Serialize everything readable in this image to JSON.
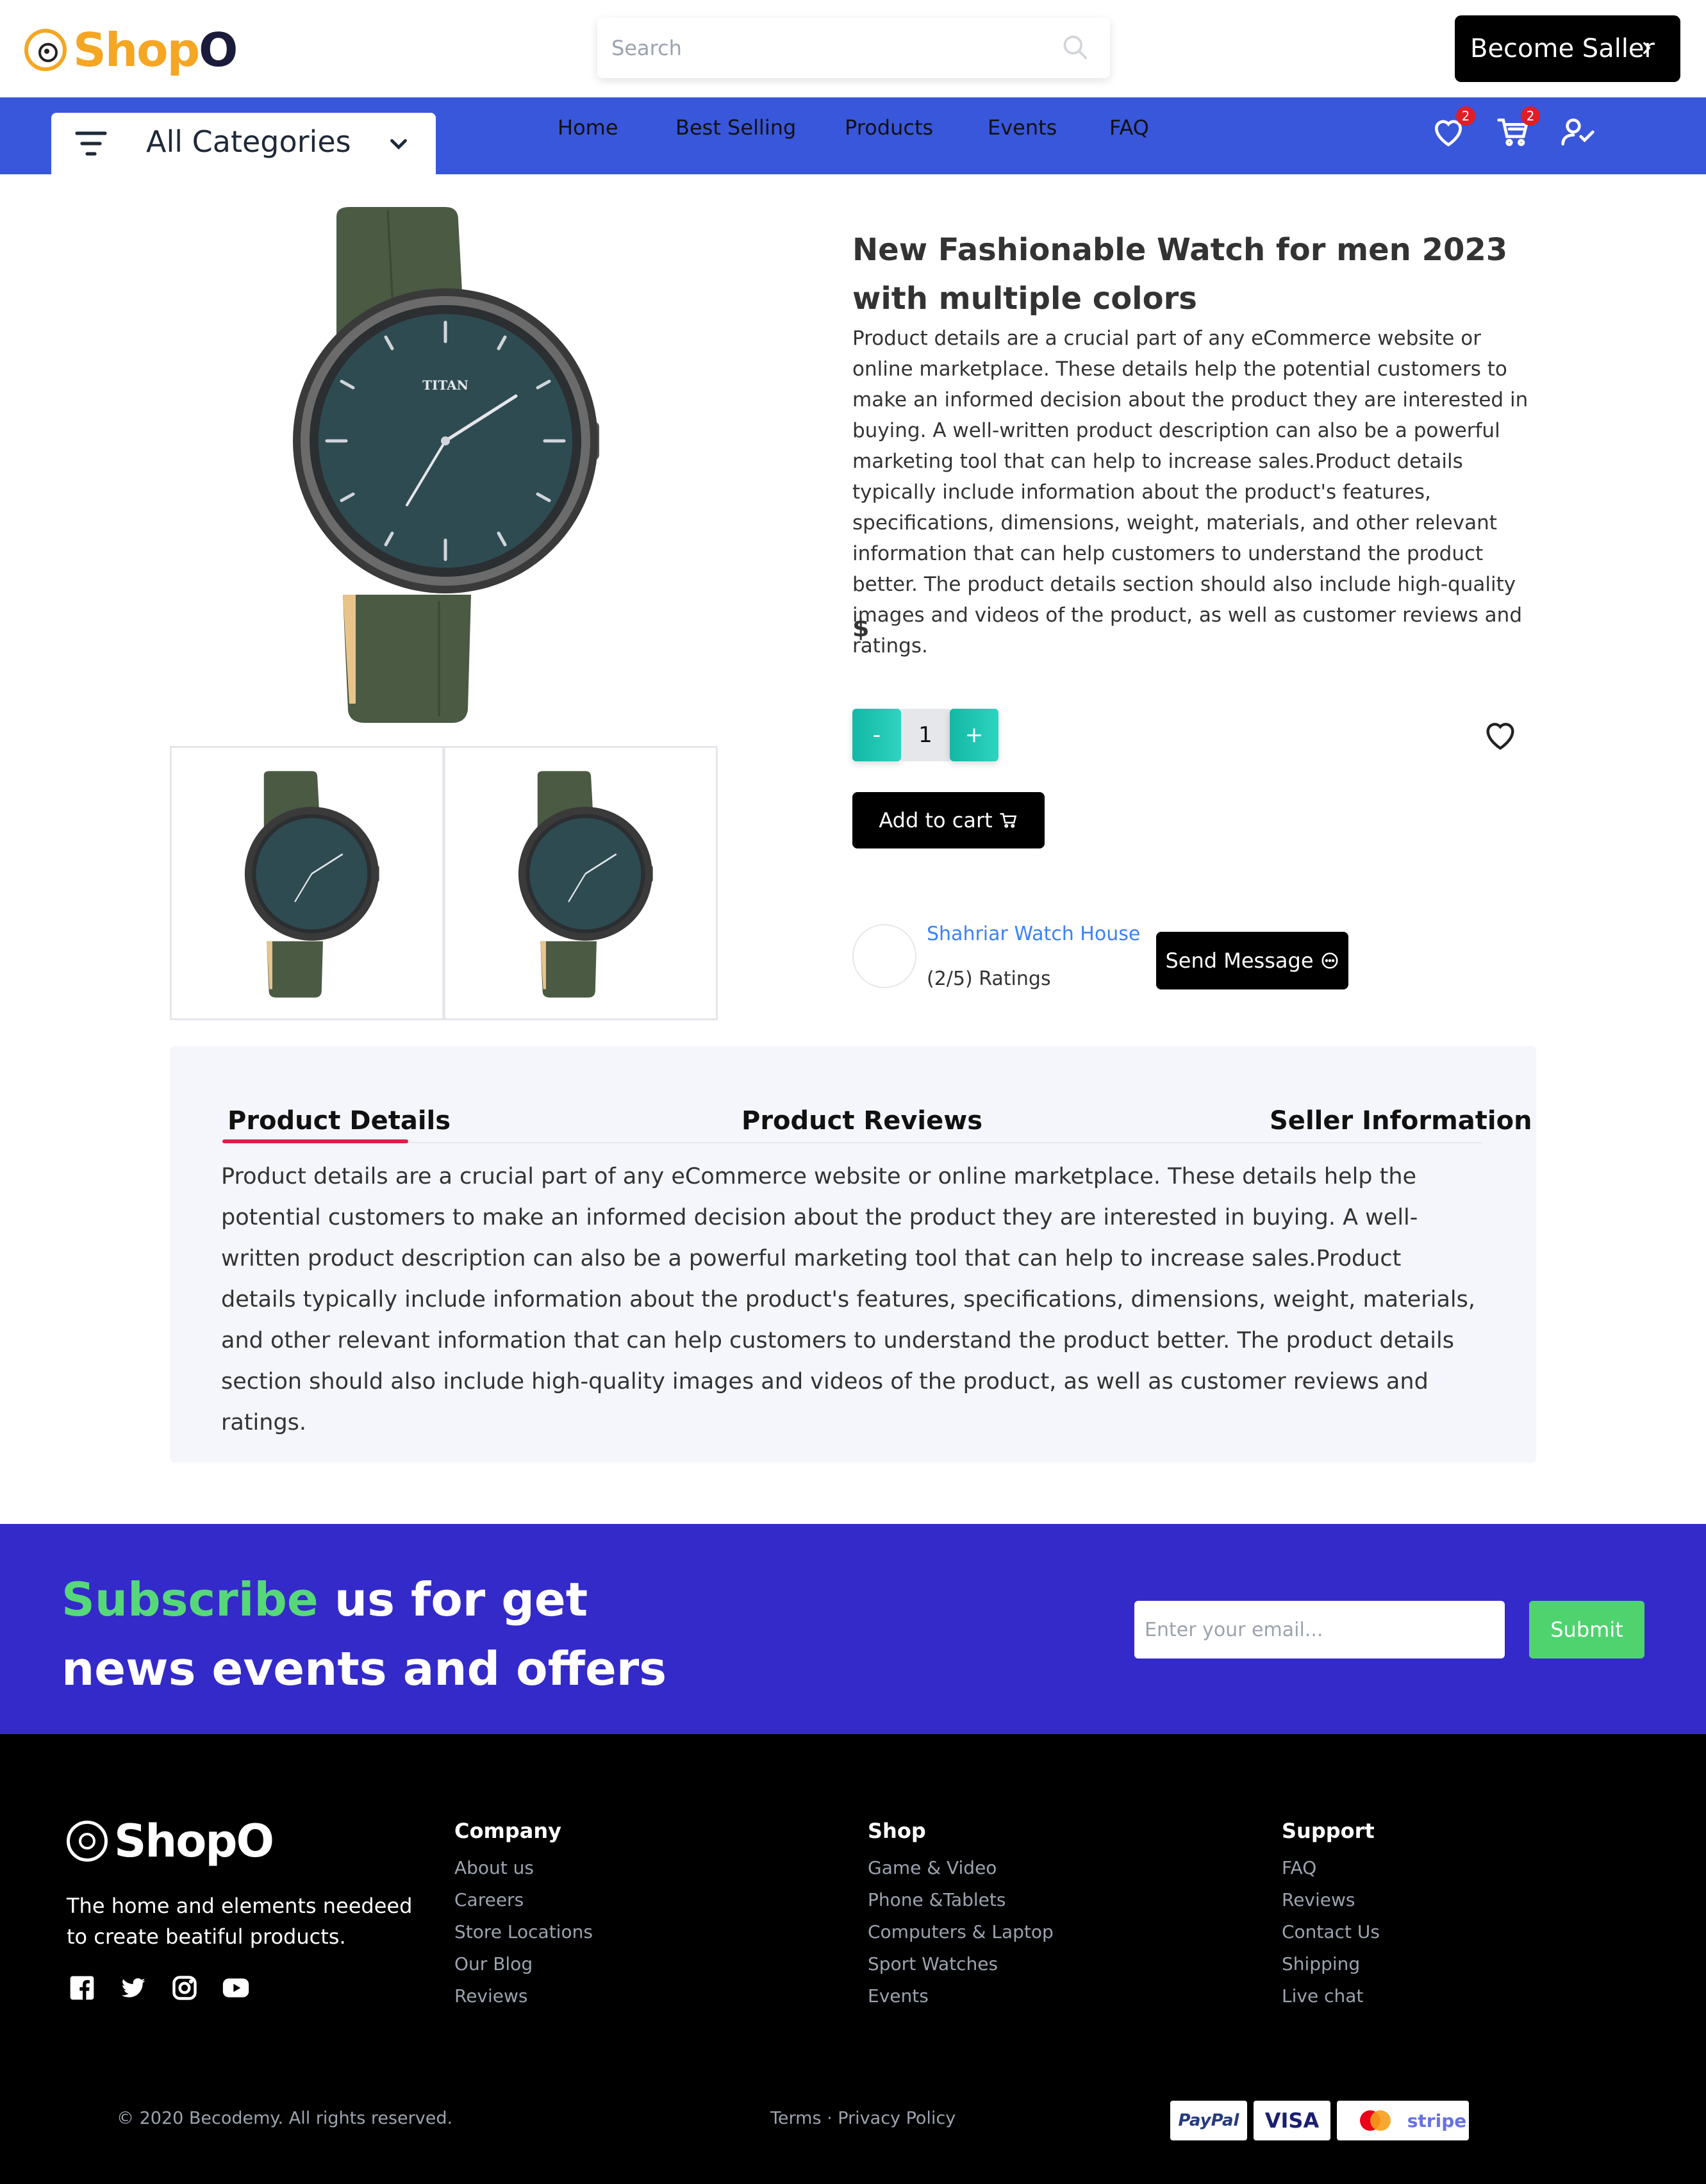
{
  "header": {
    "logo_text": "Shop",
    "logo_o": "O",
    "search_placeholder": "Search",
    "become_seller": "Become Saller"
  },
  "nav": {
    "categories_label": "All Categories",
    "links": [
      "Home",
      "Best Selling",
      "Products",
      "Events",
      "FAQ"
    ],
    "wishlist_count": "2",
    "cart_count": "2"
  },
  "product": {
    "title": "New Fashionable Watch for men 2023 with multiple colors",
    "description": "Product details are a crucial part of any eCommerce website or online marketplace. These details help the potential customers to make an informed decision about the product they are interested in buying. A well-written product description can also be a powerful marketing tool that can help to increase sales.Product details typically include information about the product's features, specifications, dimensions, weight, materials, and other relevant information that can help customers to understand the product better. The product details section should also include high-quality images and videos of the product, as well as customer reviews and ratings.",
    "price": "$",
    "quantity": "1",
    "decrement": "-",
    "increment": "+",
    "add_to_cart": "Add to cart",
    "watch_brand": "TITAN"
  },
  "seller": {
    "name": "Shahriar Watch House",
    "ratings": "(2/5) Ratings",
    "send_message": "Send Message"
  },
  "tabs": {
    "items": [
      "Product Details",
      "Product Reviews",
      "Seller Information"
    ],
    "active": "Product Details",
    "content": "Product details are a crucial part of any eCommerce website or online marketplace. These details help the potential customers to make an informed decision about the product they are interested in buying. A well-written product description can also be a powerful marketing tool that can help to increase sales.Product details typically include information about the product's features, specifications, dimensions, weight, materials, and other relevant information that can help customers to understand the product better. The product details section should also include high-quality images and videos of the product, as well as customer reviews and ratings."
  },
  "subscribe": {
    "accent": "Subscribe",
    "rest": " us for get news events and offers",
    "email_placeholder": "Enter your email...",
    "submit": "Submit"
  },
  "footer": {
    "logo_text": "ShopO",
    "tagline": "The home and elements needeed to create beatiful products.",
    "columns": [
      {
        "title": "Company",
        "items": [
          "About us",
          "Careers",
          "Store Locations",
          "Our Blog",
          "Reviews"
        ]
      },
      {
        "title": "Shop",
        "items": [
          "Game & Video",
          "Phone &Tablets",
          "Computers & Laptop",
          "Sport Watches",
          "Events"
        ]
      },
      {
        "title": "Support",
        "items": [
          "FAQ",
          "Reviews",
          "Contact Us",
          "Shipping",
          "Live chat"
        ]
      }
    ],
    "copyright": "© 2020 Becodemy. All rights reserved.",
    "legal": "Terms · Privacy Policy",
    "payments": [
      "PayPal",
      "VISA",
      "Mastercard",
      "stripe"
    ]
  },
  "colors": {
    "nav_bg": "#3957db",
    "brand_orange": "#f5a623",
    "teal": "#14b8a6",
    "subscribe_bg": "#342ac9",
    "subscribe_accent": "#56d879",
    "tab_underline": "#e11d48",
    "badge": "#e11d26"
  }
}
